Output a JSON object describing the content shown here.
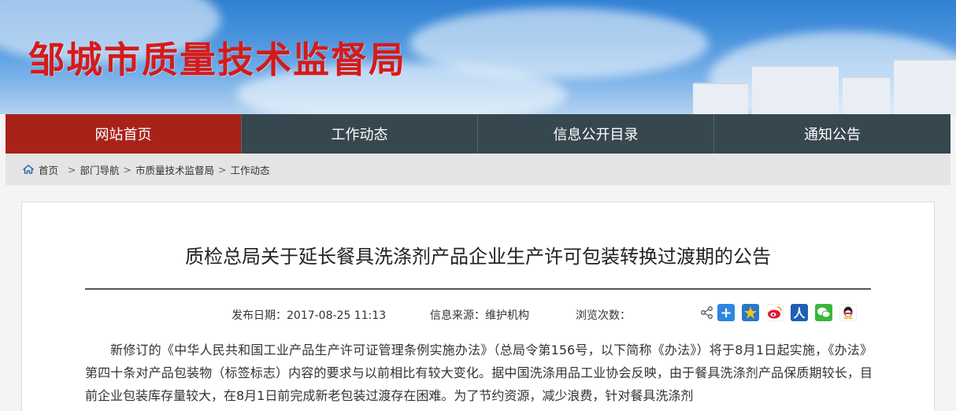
{
  "site": {
    "title": "邹城市质量技术监督局"
  },
  "nav": {
    "items": [
      {
        "label": "网站首页"
      },
      {
        "label": "工作动态"
      },
      {
        "label": "信息公开目录"
      },
      {
        "label": "通知公告"
      }
    ]
  },
  "breadcrumb": {
    "home": "首页",
    "items": [
      "部门导航",
      "市质量技术监督局",
      "工作动态"
    ],
    "separator": ">"
  },
  "article": {
    "title": "质检总局关于延长餐具洗涤剂产品企业生产许可包装转换过渡期的公告",
    "publish_label": "发布日期：",
    "publish_date": "2017-08-25 11:13",
    "source_label": "信息来源：",
    "source": "维护机构",
    "views_label": "浏览次数：",
    "body": "新修订的《中华人民共和国工业产品生产许可证管理条例实施办法》（总局令第156号，以下简称《办法》）将于8月1日起实施，《办法》第四十条对产品包装物（标签标志）内容的要求与以前相比有较大变化。据中国洗涤用品工业协会反映，由于餐具洗涤剂产品保质期较长，目前企业包装库存量较大，在8月1日前完成新老包装过渡存在困难。为了节约资源，减少浪费，针对餐具洗涤剂"
  },
  "share": {
    "icons": [
      "share-icon",
      "plus-share-icon",
      "qzone-icon",
      "weibo-icon",
      "renren-icon",
      "wechat-icon",
      "qq-icon"
    ]
  },
  "colors": {
    "title_red": "#d61a1a",
    "nav_bg": "#37474f",
    "nav_active": "#a8221a"
  }
}
